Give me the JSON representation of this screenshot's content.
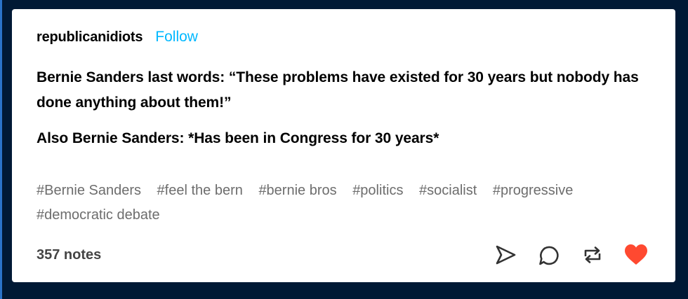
{
  "post": {
    "blog_name": "republicanidiots",
    "follow_label": "Follow",
    "body": [
      "Bernie Sanders last words: “These problems have existed for 30 years but nobody has done anything about them!”",
      "Also Bernie Sanders: *Has been in Congress for 30 years*"
    ],
    "tags": [
      "#Bernie Sanders",
      "#feel the bern",
      "#bernie bros",
      "#politics",
      "#socialist",
      "#progressive",
      "#democratic debate"
    ],
    "notes": "357 notes"
  },
  "actions": [
    {
      "icon": "share-icon",
      "label": "share"
    },
    {
      "icon": "reply-icon",
      "label": "reply"
    },
    {
      "icon": "reblog-icon",
      "label": "reblog"
    },
    {
      "icon": "heart-icon",
      "label": "like",
      "active": true
    }
  ],
  "colors": {
    "page_background": "#001935",
    "card_background": "#ffffff",
    "follow_link": "#00b8ff",
    "tag_text": "#6d6d6d",
    "like_active": "#ff4930"
  }
}
